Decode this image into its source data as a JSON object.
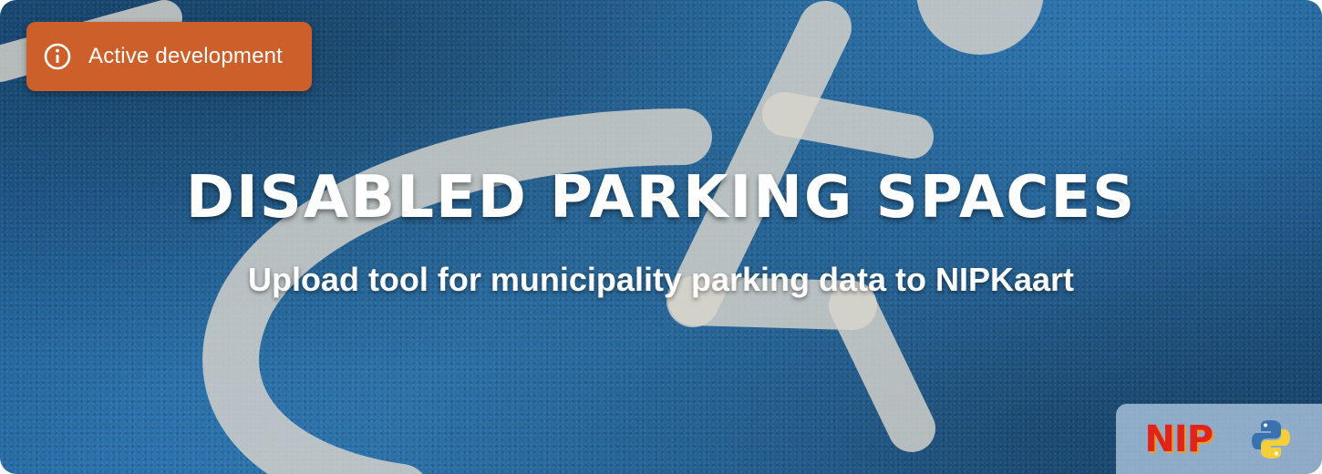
{
  "badge": {
    "icon": "info-icon",
    "label": "Active development",
    "color": "#cd5f2a"
  },
  "title": "DISABLED PARKING SPACES",
  "subtitle": "Upload tool for municipality parking data to NIPKaart",
  "logos": {
    "nip": "NIP",
    "python_icon": "python-icon"
  },
  "background_icon": "wheelchair-icon",
  "colors": {
    "background": "#2a6fa8",
    "symbol": "#d8d4cc"
  }
}
